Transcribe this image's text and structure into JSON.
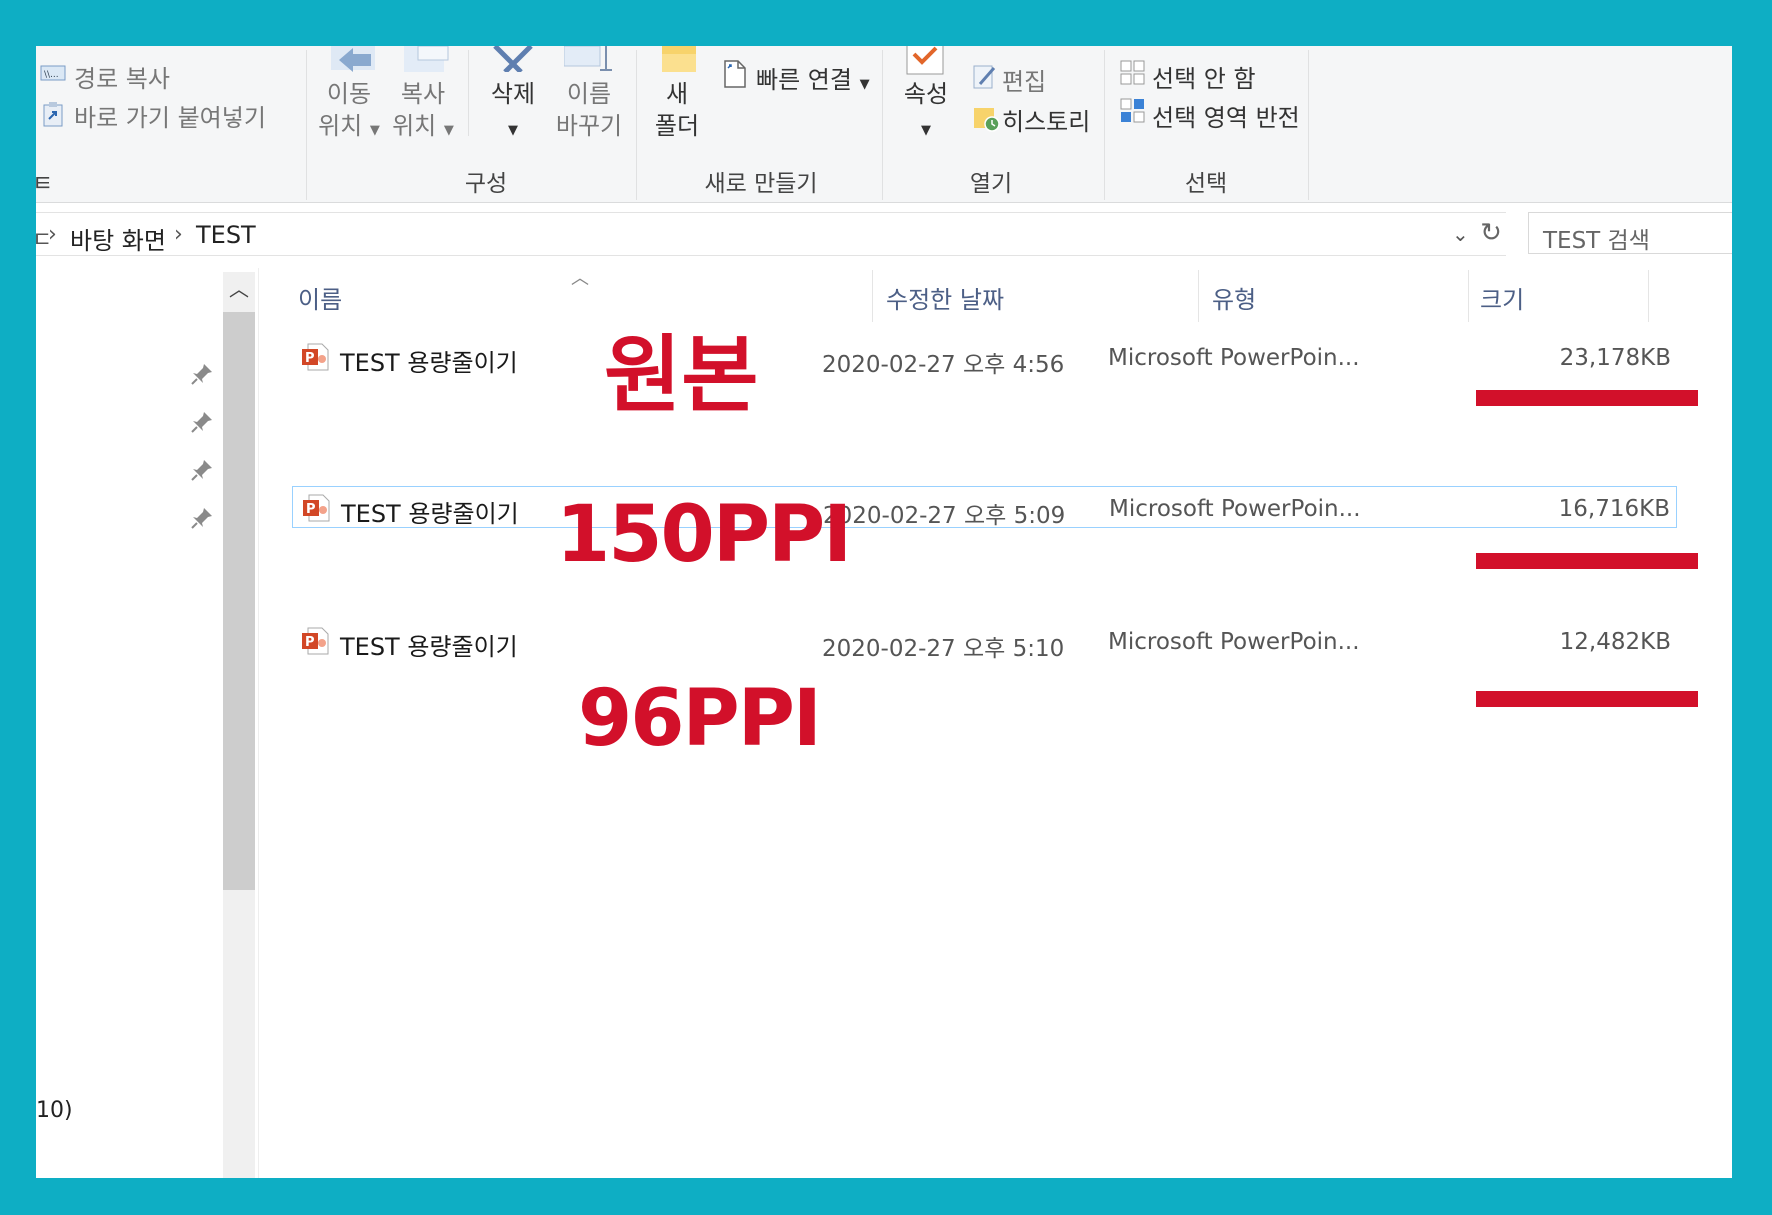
{
  "ribbon": {
    "clipboard": {
      "copy_path": "경로 복사",
      "paste_shortcut": "바로 가기 붙여넣기",
      "group_fragment": "ㅌ"
    },
    "organize": {
      "move_to": [
        "이동",
        "위치"
      ],
      "copy_to": [
        "복사",
        "위치"
      ],
      "delete": "삭제",
      "rename": [
        "이름",
        "바꾸기"
      ],
      "group_label": "구성"
    },
    "new": {
      "new_folder": [
        "새",
        "폴더"
      ],
      "easy_access": "빠른 연결",
      "group_label": "새로 만들기"
    },
    "open": {
      "properties": "속성",
      "edit": "편집",
      "history": "히스토리",
      "group_label": "열기"
    },
    "select": {
      "select_none": "선택 안 함",
      "invert_selection": "선택 영역 반전",
      "group_label": "선택"
    }
  },
  "address": {
    "crumbs": [
      "바탕 화면",
      "TEST"
    ],
    "search_placeholder": "TEST 검색"
  },
  "nav": {
    "status_fragment": "10)"
  },
  "columns": {
    "name": "이름",
    "date": "수정한 날짜",
    "type": "유형",
    "size": "크기"
  },
  "files": [
    {
      "name": "TEST 용량줄이기",
      "date": "2020-02-27 오후 4:56",
      "type": "Microsoft PowerPoin...",
      "size": "23,178KB",
      "annotation": "원본",
      "selected": false
    },
    {
      "name": "TEST 용량줄이기",
      "date": "2020-02-27 오후 5:09",
      "type": "Microsoft PowerPoin...",
      "size": "16,716KB",
      "annotation": "150PPI",
      "selected": true
    },
    {
      "name": "TEST 용량줄이기",
      "date": "2020-02-27 오후 5:10",
      "type": "Microsoft PowerPoin...",
      "size": "12,482KB",
      "annotation": "96PPI",
      "selected": false
    }
  ],
  "colors": {
    "frame": "#0eaec4",
    "annotation": "#d2102a",
    "selection_border": "#99d1ff",
    "header_text": "#4c5f86"
  }
}
